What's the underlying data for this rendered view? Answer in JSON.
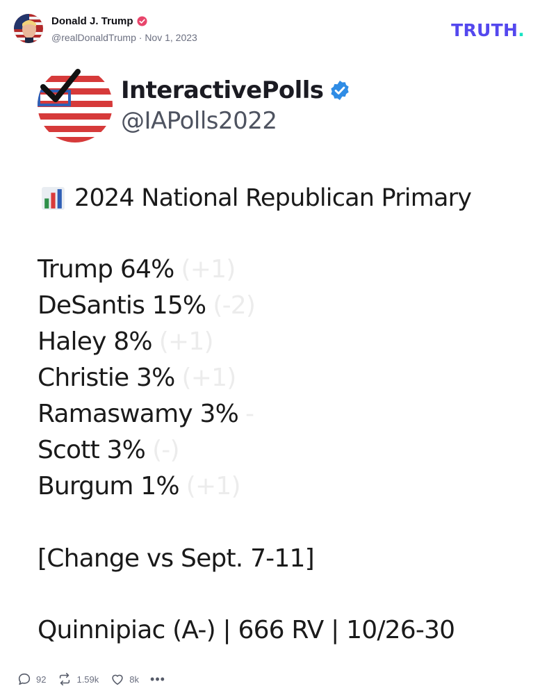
{
  "post": {
    "author_name": "Donald J. Trump",
    "author_handle": "@realDonaldTrump",
    "separator": "·",
    "date": "Nov 1, 2023",
    "brand": {
      "text": "TRUTH",
      "dot": "."
    }
  },
  "embed": {
    "account_name": "InteractivePolls",
    "account_handle": "@IAPolls2022",
    "headline": "2024 National Republican Primary",
    "headline_icon": "bar-chart-icon",
    "results": [
      {
        "text": "Trump 64%",
        "faded": "(+1)"
      },
      {
        "text": "DeSantis 15%",
        "faded": "(-2)"
      },
      {
        "text": "Haley 8%",
        "faded": "(+1)"
      },
      {
        "text": "Christie 3%",
        "faded": "(+1)"
      },
      {
        "text": "Ramaswamy 3%",
        "faded": "-"
      },
      {
        "text": "Scott 3%",
        "faded": "(-)"
      },
      {
        "text": "Burgum 1%",
        "faded": "(+1)"
      }
    ],
    "change_note": "[Change vs Sept. 7-11]",
    "source_line": "Quinnipiac (A-) | 666 RV | 10/26-30"
  },
  "actions": {
    "replies": "92",
    "retruths": "1.59k",
    "likes": "8k",
    "more": "•••"
  },
  "colors": {
    "brand": "#5448ee",
    "brand_dot": "#17e3c2",
    "verified_pink": "#e8456b",
    "verified_blue": "#2f8ce5",
    "flag_red": "#d63a3a",
    "flag_blue": "#2f5fb5"
  }
}
